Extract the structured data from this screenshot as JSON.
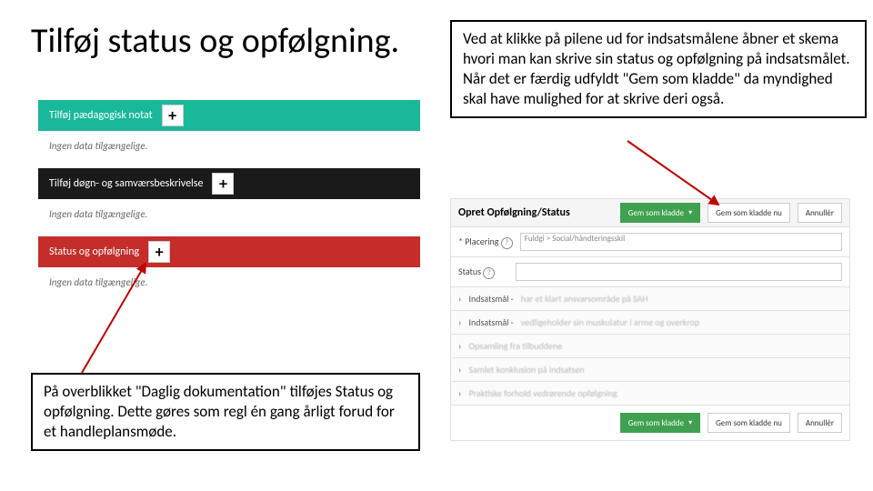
{
  "title": "Tilføj status og opfølgning.",
  "info_top": "Ved at klikke på pilene ud for indsatsmålene åbner et skema hvori man kan skrive sin status og opfølgning på indsatsmålet. Når det er færdig udfyldt \"Gem som kladde\" da myndighed skal have mulighed for at skrive deri også.",
  "info_bottom": "På overblikket \"Daglig dokumentation\" tilføjes Status og opfølgning. Dette gøres som regl én gang årligt forud for et handleplansmøde.",
  "left": {
    "bar1": "Tilføj pædagogisk notat",
    "bar2": "Tilføj døgn- og samværsbeskrivelse",
    "bar3": "Status og opfølgning",
    "no_data": "Ingen data tilgængelige."
  },
  "form": {
    "header_title": "Opret Opfølgning/Status",
    "btn_green": "Gem som kladde",
    "btn_save_now": "Gem som kladde nu",
    "btn_cancel": "Annullér",
    "placering_lbl": "Placering",
    "placering_val": "Fuldgi > Social/håndteringsskil",
    "status_lbl": "Status",
    "rows": {
      "r1a": "Indsatsmål -",
      "r1b": "har et klart ansvarsområde på SAH",
      "r2a": "Indsatsmål -",
      "r2b": "vedligeholder sin muskulatur i arme og overkrop",
      "r3": "Opsamling fra tilbuddene",
      "r4": "Samlet konklusion på indsatsen",
      "r5": "Praktiske forhold vedrørende opfølgning"
    }
  }
}
